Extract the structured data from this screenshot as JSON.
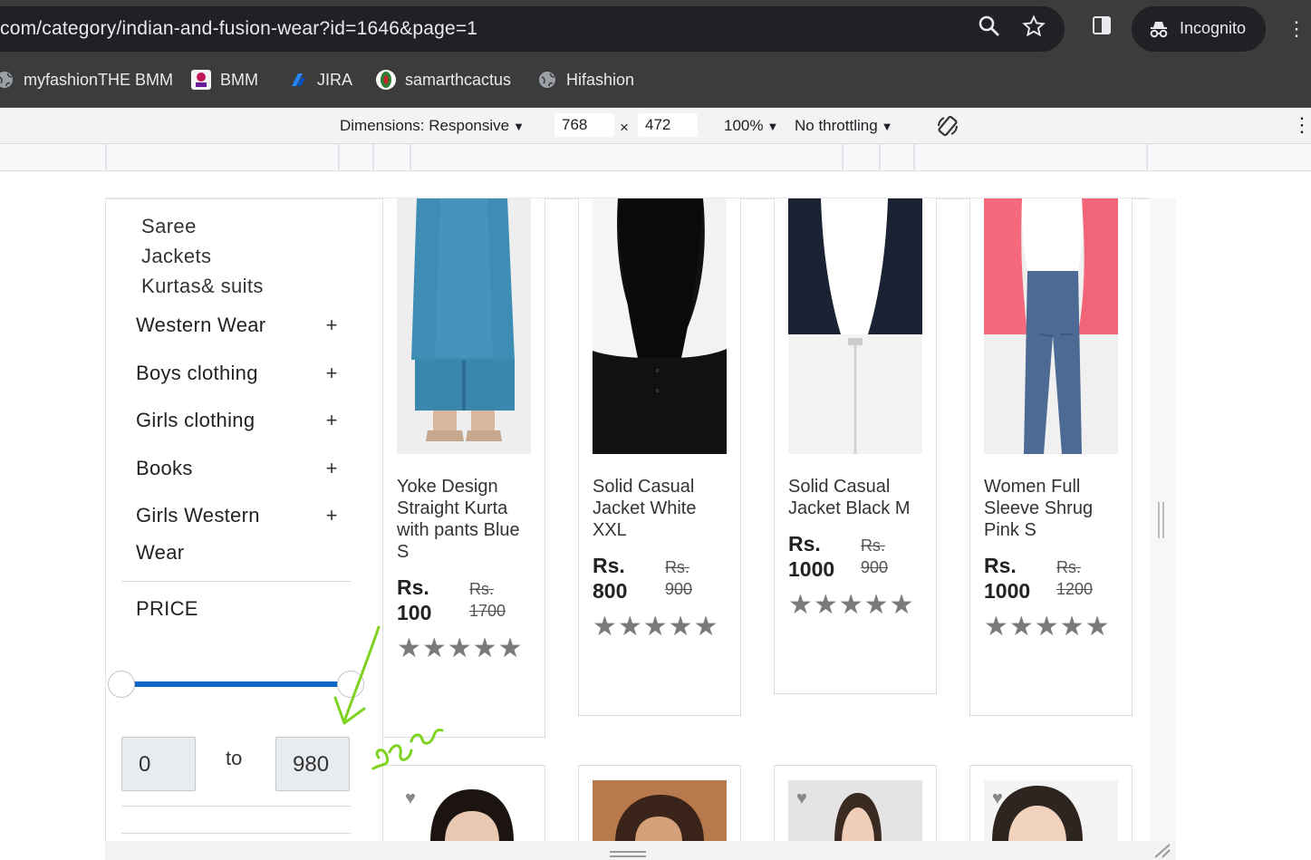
{
  "browser": {
    "url": "com/category/indian-and-fusion-wear?id=1646&page=1",
    "incognito_label": "Incognito",
    "bookmarks": [
      {
        "label": "myfashionTHE BMM",
        "icon": "globe-icon"
      },
      {
        "label": "BMM",
        "icon": "bmm-favicon-icon"
      },
      {
        "label": "JIRA",
        "icon": "jira-icon"
      },
      {
        "label": "samarthcactus",
        "icon": "cactus-icon"
      },
      {
        "label": "Hifashion",
        "icon": "globe-icon"
      }
    ]
  },
  "devtools": {
    "dimensions_label": "Dimensions: Responsive",
    "width": "768",
    "x_sign": "×",
    "height": "472",
    "zoom": "100%",
    "throttling": "No throttling"
  },
  "sidebar": {
    "subcategories": [
      "Saree",
      "Jackets",
      "Kurtas& suits"
    ],
    "categories": [
      {
        "label": "Western Wear",
        "toggle": "+"
      },
      {
        "label": "Boys clothing",
        "toggle": "+"
      },
      {
        "label": "Girls clothing",
        "toggle": "+"
      },
      {
        "label": "Books",
        "toggle": "+"
      },
      {
        "label": "Girls Western",
        "label2": "Wear",
        "toggle": "+"
      }
    ],
    "price_title": "PRICE",
    "price_min": "0",
    "price_to": "to",
    "price_max": "980",
    "slider_low_fraction": 0.0,
    "slider_high_fraction": 1.0
  },
  "products": [
    {
      "name": "Yoke Design Straight Kurta with pants Blue S",
      "price_label": "Rs.",
      "price_value": "100",
      "old_label": "Rs.",
      "old_value": "1700",
      "stars": "★★★★★"
    },
    {
      "name": "Solid Casual Jacket White XXL",
      "price_label": "Rs.",
      "price_value": "800",
      "old_label": "Rs.",
      "old_value": "900",
      "stars": "★★★★★"
    },
    {
      "name": "Solid Casual Jacket Black M",
      "price_label": "Rs.",
      "price_value": "1000",
      "old_label": "Rs.",
      "old_value": "900",
      "stars": "★★★★★"
    },
    {
      "name": "Women Full Sleeve Shrug Pink S",
      "price_label": "Rs.",
      "price_value": "1000",
      "old_label": "Rs.",
      "old_value": "1200",
      "stars": "★★★★★"
    }
  ],
  "colors": {
    "slider": "#0a66c2",
    "annotation": "#7ed321",
    "star": "#7a7a7a"
  }
}
